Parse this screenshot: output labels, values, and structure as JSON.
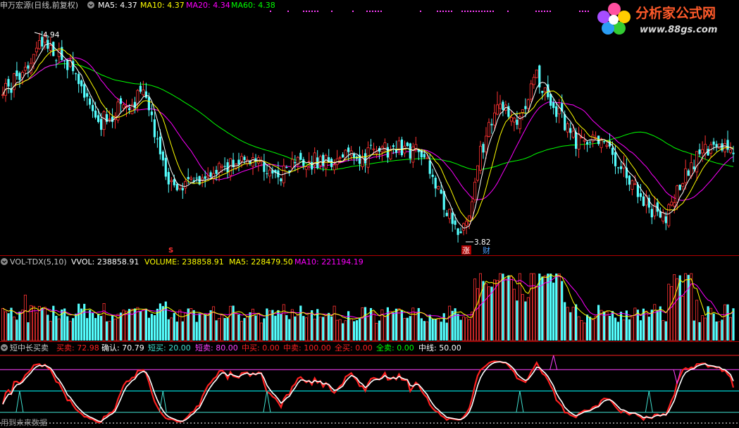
{
  "colors": {
    "background": "#000000",
    "up": "#ff3232",
    "down": "#54ffff",
    "ma5": "#ffffff",
    "ma10": "#ffff00",
    "ma20": "#ff00ff",
    "ma60": "#00ff00",
    "panel_border": "#b00000",
    "buy": "#ff2020",
    "confirm": "#ffffff",
    "short_buy": "#40e0d0",
    "short_sell": "#ff40ff",
    "mid_line": "#00ffff"
  },
  "main": {
    "stock_name": "申万宏源(日线,前复权)",
    "ma5_label": "MA5: 4.37",
    "ma10_label": "MA10: 4.37",
    "ma20_label": "MA20: 4.34",
    "ma60_label": "MA60: 4.38",
    "high_label": "4.94",
    "low_label": "3.82",
    "marker_s": "S",
    "marker_zhang": "涨",
    "marker_cai": "财"
  },
  "volume": {
    "name": "VOL-TDX(5,10)",
    "vvol_label": "VVOL: 238858.91",
    "volume_label": "VOLUME: 238858.91",
    "ma5_label": "MA5: 228479.50",
    "ma10_label": "MA10: 221194.19"
  },
  "indicator": {
    "name": "短中长买卖",
    "buy_label": "买卖: 72.98",
    "confirm_label": "确认: 70.79",
    "short_buy_label": "短买: 20.00",
    "short_sell_label": "短卖: 80.00",
    "mid_buy_label": "中买: 0.00",
    "mid_sell_label": "中卖: 100.00",
    "all_buy_label": "全买: 0.00",
    "all_sell_label": "全卖: 0.00",
    "mid_line_label": "中线: 50.00",
    "footer": "用到未来数据"
  },
  "logo": {
    "title": "分析家公式网",
    "url": "www.88gs.com"
  },
  "chart_data": {
    "type": "candlestick",
    "anchors": [
      [
        0,
        4.6
      ],
      [
        8,
        4.75
      ],
      [
        14,
        4.9
      ],
      [
        24,
        4.75
      ],
      [
        34,
        4.45
      ],
      [
        44,
        4.55
      ],
      [
        50,
        4.6
      ],
      [
        54,
        4.4
      ],
      [
        58,
        4.15
      ],
      [
        66,
        4.12
      ],
      [
        78,
        4.22
      ],
      [
        88,
        4.28
      ],
      [
        96,
        4.15
      ],
      [
        104,
        4.25
      ],
      [
        116,
        4.25
      ],
      [
        128,
        4.28
      ],
      [
        140,
        4.32
      ],
      [
        150,
        4.3
      ],
      [
        154,
        4.15
      ],
      [
        158,
        4.0
      ],
      [
        162,
        3.88
      ],
      [
        166,
        3.95
      ],
      [
        170,
        4.3
      ],
      [
        176,
        4.55
      ],
      [
        184,
        4.45
      ],
      [
        190,
        4.7
      ],
      [
        196,
        4.55
      ],
      [
        204,
        4.35
      ],
      [
        210,
        4.4
      ],
      [
        216,
        4.3
      ],
      [
        224,
        4.15
      ],
      [
        230,
        4.0
      ],
      [
        236,
        3.95
      ],
      [
        242,
        4.15
      ],
      [
        248,
        4.3
      ],
      [
        256,
        4.35
      ],
      [
        260,
        4.33
      ]
    ],
    "price_range": [
      3.82,
      4.94
    ],
    "indicator_range": [
      0,
      100
    ],
    "ma_periods": [
      5,
      10,
      20,
      60
    ]
  }
}
